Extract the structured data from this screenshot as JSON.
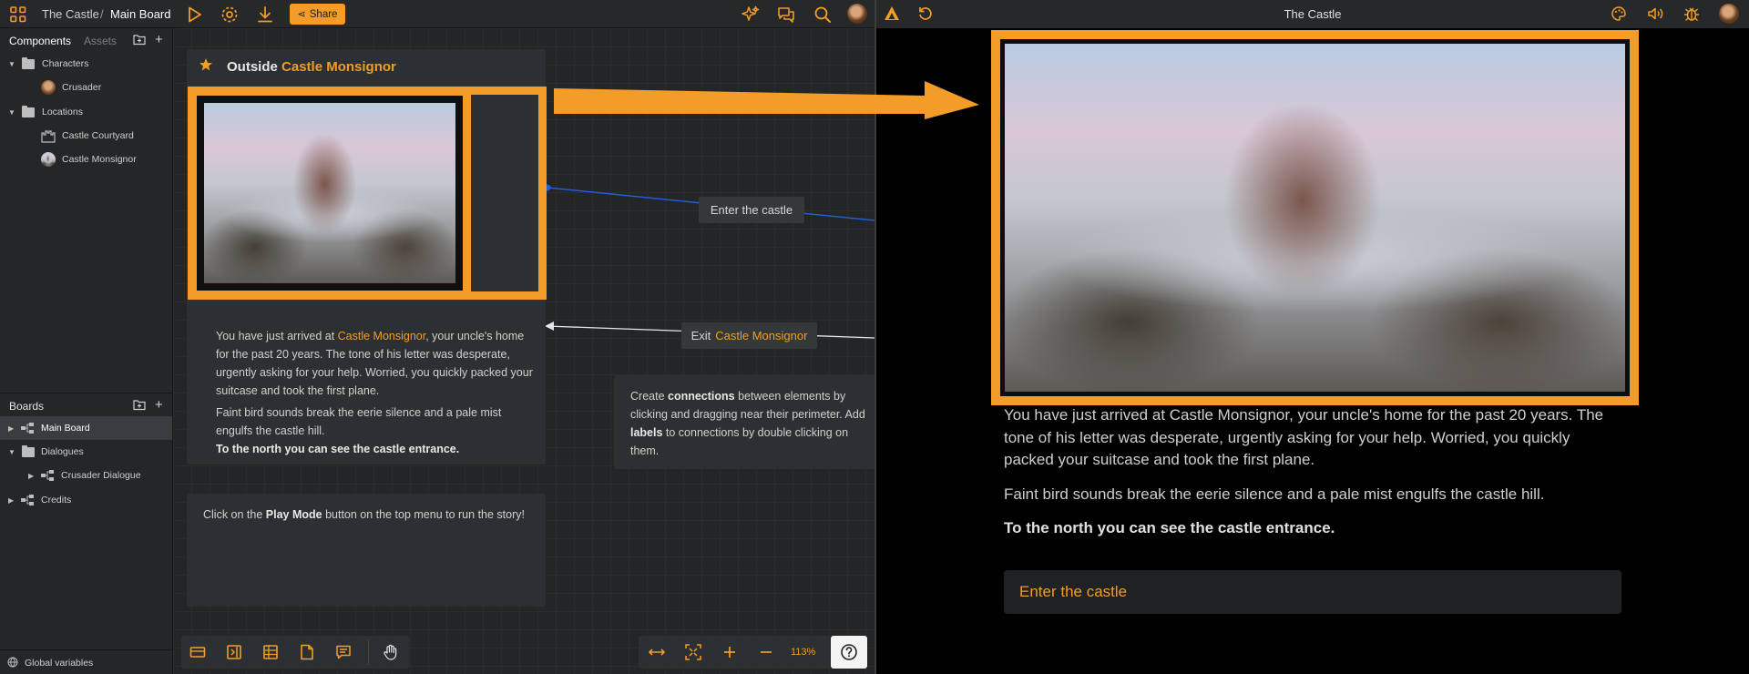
{
  "topbar": {
    "project": "The Castle",
    "separator": "/",
    "board": "Main Board",
    "share_label": "Share"
  },
  "sidebar": {
    "tabs": [
      "Components",
      "Assets"
    ],
    "tree": [
      {
        "label": "Characters"
      },
      {
        "label": "Crusader"
      },
      {
        "label": "Locations"
      },
      {
        "label": "Castle Courtyard"
      },
      {
        "label": "Castle Monsignor"
      }
    ],
    "boards_title": "Boards",
    "boards": [
      {
        "label": "Main Board"
      },
      {
        "label": "Dialogues"
      },
      {
        "label": "Crusader Dialogue"
      },
      {
        "label": "Credits"
      }
    ],
    "footer": "Global variables"
  },
  "node": {
    "title_prefix": "Outside",
    "title_highlight": "Castle Monsignor",
    "p1_a": "You have just arrived at ",
    "p1_link": "Castle Monsignor",
    "p1_b": ", your uncle's home for the past 20 years. The tone of his letter was desperate, urgently asking for your help. Worried, you quickly packed your suitcase and took the first plane.",
    "p2": "Faint bird sounds break the eerie silence and a pale mist engulfs the castle hill.",
    "p3": "To the north you can see the castle entrance."
  },
  "connections": {
    "enter_label": "Enter the castle",
    "exit_prefix": "Exit",
    "exit_highlight": "Castle Monsignor"
  },
  "hint_connections": {
    "a": "Create ",
    "b": "connections",
    "c": " between elements by clicking and dragging near their perimeter. Add ",
    "d": "labels",
    "e": " to connections by double clicking on them."
  },
  "hint_play": {
    "a": "Click on the ",
    "b": "Play Mode",
    "c": " button on the top menu to run the story!"
  },
  "zoom": "113%",
  "player": {
    "title": "The Castle",
    "p1": "You have just arrived at Castle Monsignor, your uncle's home for the past 20 years. The tone of his letter was desperate, urgently asking for your help. Worried, you quickly packed your suitcase and took the first plane.",
    "p2": "Faint bird sounds break the eerie silence and a pale mist engulfs the castle hill.",
    "p3": "To the north you can see the castle entrance.",
    "choice": "Enter the castle"
  },
  "colors": {
    "accent": "#f39c27",
    "connection_line": "#1f5fd8",
    "panel": "#2d3032"
  },
  "icons": [
    "grid-icon",
    "play-icon",
    "gear-icon",
    "download-icon",
    "share-icon",
    "sparkle-icon",
    "chat-icon",
    "search-icon",
    "star-icon",
    "restart-icon",
    "palette-icon",
    "volume-icon",
    "bug-icon",
    "help-icon",
    "hand-icon"
  ]
}
